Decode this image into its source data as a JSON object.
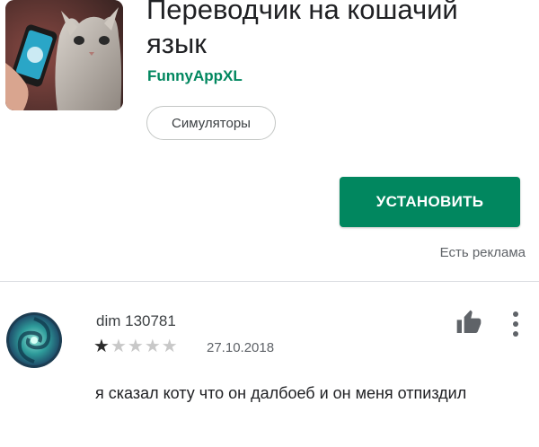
{
  "app": {
    "title": "Переводчик на кошачий язык",
    "developer": "FunnyAppXL",
    "category": "Симуляторы",
    "install_label": "УСТАНОВИТЬ",
    "ads_note": "Есть реклама",
    "icon": "cat-with-phone-app-icon"
  },
  "review": {
    "author": "dim 130781",
    "rating": 1,
    "max_rating": 5,
    "date": "27.10.2018",
    "text": "я сказал коту что он далбоеб и он меня отпиздил",
    "avatar_icon": "swirl-avatar-icon",
    "helpful_icon": "thumbs-up-icon",
    "menu_icon": "more-vertical-icon"
  },
  "colors": {
    "accent": "#01875f",
    "star_on": "#2b2b2b",
    "star_off": "#c8c8c8"
  }
}
